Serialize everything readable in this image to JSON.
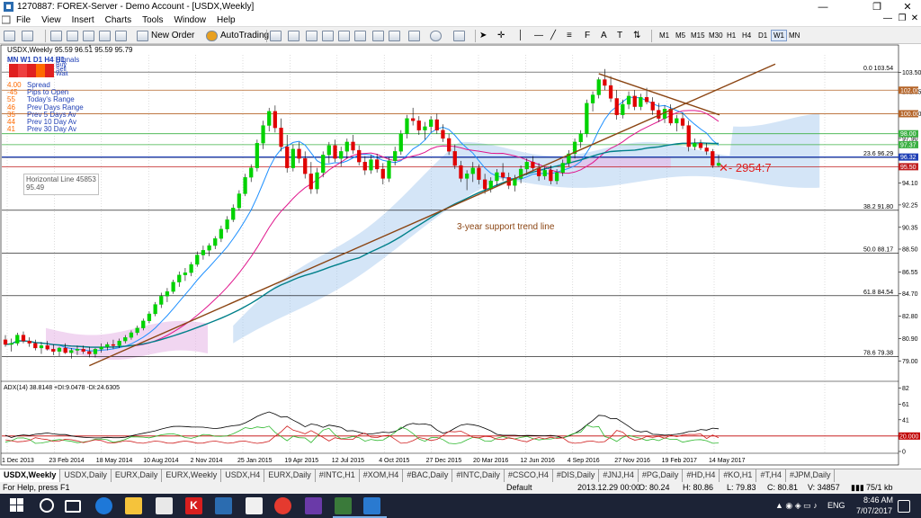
{
  "window": {
    "title": "1270887: FOREX-Server - Demo Account - [USDX,Weekly]",
    "minimize": "—",
    "maximize": "❐",
    "close": "✕"
  },
  "menu": {
    "items": [
      "File",
      "View",
      "Insert",
      "Charts",
      "Tools",
      "Window",
      "Help"
    ]
  },
  "toolbar": {
    "new_order": "New Order",
    "autotrading": "AutoTrading",
    "timeframes": [
      "M1",
      "M5",
      "M15",
      "M30",
      "H1",
      "H4",
      "D1",
      "W1",
      "MN"
    ],
    "active_timeframe": "W1"
  },
  "chart": {
    "header": "USDX,Weekly  95.59 96.51 95.59 95.79",
    "signals_panel": {
      "timeframes": "MN W1 D1  H4  H1",
      "signals": "Signals",
      "buy": "Buy",
      "sell": "Sell",
      "wait": "Wait",
      "lines": [
        {
          "value": "4.00",
          "label": "Spread"
        },
        {
          "value": "-45",
          "label": "Pips to Open"
        },
        {
          "value": "55",
          "label": "Today's Range"
        },
        {
          "value": "46",
          "label": "Prev Days Range"
        },
        {
          "value": "35",
          "label": "Prev 5 Days Av"
        },
        {
          "value": "44",
          "label": "Prev 10 Day Av"
        },
        {
          "value": "41",
          "label": "Prev 30 Day Av"
        }
      ]
    },
    "tooltip": {
      "line1": "Horizontal Line 45853",
      "line2": "95.49"
    },
    "annotation_trendline": "3-year support trend line",
    "annotation_target": "2954:7",
    "fib_levels": [
      {
        "label": "0.0  103.54",
        "price": 103.54
      },
      {
        "label": "23.6  96.29",
        "price": 96.29
      },
      {
        "label": "38.2  91.80",
        "price": 91.8
      },
      {
        "label": "50.0  88.17",
        "price": 88.17
      },
      {
        "label": "61.8  84.54",
        "price": 84.54
      },
      {
        "label": "78.6  79.38",
        "price": 79.38
      }
    ],
    "price_axis": [
      "103.50",
      "101.85",
      "100.00",
      "97.90",
      "96.32",
      "94.10",
      "92.25",
      "90.35",
      "88.50",
      "86.55",
      "84.70",
      "82.80",
      "80.90",
      "79.00"
    ],
    "price_tags": [
      {
        "text": "102.00",
        "price": 102.0,
        "color": "#b46428"
      },
      {
        "text": "100.00",
        "price": 100.0,
        "color": "#b46428"
      },
      {
        "text": "98.00",
        "price": 98.3,
        "color": "#3cb043"
      },
      {
        "text": "97.37",
        "price": 97.37,
        "color": "#3cb043"
      },
      {
        "text": "96.32",
        "price": 96.32,
        "color": "#1f3fb5"
      },
      {
        "text": "95.50",
        "price": 95.5,
        "color": "#c02020"
      }
    ],
    "time_axis": [
      "1 Dec 2013",
      "23 Feb 2014",
      "18 May 2014",
      "10 Aug 2014",
      "2 Nov 2014",
      "25 Jan 2015",
      "19 Apr 2015",
      "12 Jul 2015",
      "4 Oct 2015",
      "27 Dec 2015",
      "20 Mar 2016",
      "12 Jun 2016",
      "4 Sep 2016",
      "27 Nov 2016",
      "19 Feb 2017",
      "14 May 2017"
    ],
    "adx_header": "ADX(14) 38.8148 +DI:9.0478 -DI:24.6305",
    "adx_axis": [
      "82",
      "61",
      "41",
      "20",
      "0"
    ],
    "adx_tag": "20.000"
  },
  "chart_data": {
    "type": "candlestick",
    "title": "USDX,Weekly",
    "ylim": [
      77.5,
      105
    ],
    "candles": [
      [
        80.8,
        81.2,
        80.2,
        80.4
      ],
      [
        80.4,
        80.9,
        79.8,
        80.5
      ],
      [
        80.5,
        81.4,
        80.3,
        81.2
      ],
      [
        81.2,
        81.5,
        80.5,
        80.7
      ],
      [
        80.7,
        81.0,
        80.2,
        80.5
      ],
      [
        80.5,
        80.8,
        79.9,
        80.1
      ],
      [
        80.1,
        80.6,
        79.6,
        80.3
      ],
      [
        80.3,
        80.7,
        79.9,
        80.0
      ],
      [
        80.0,
        80.4,
        79.5,
        79.8
      ],
      [
        79.8,
        80.2,
        79.4,
        80.1
      ],
      [
        80.1,
        80.5,
        79.6,
        79.7
      ],
      [
        79.7,
        80.1,
        79.2,
        79.9
      ],
      [
        79.9,
        80.3,
        79.5,
        80.0
      ],
      [
        80.0,
        80.3,
        79.6,
        79.8
      ],
      [
        79.8,
        80.2,
        79.3,
        79.6
      ],
      [
        79.6,
        80.1,
        79.3,
        80.0
      ],
      [
        80.0,
        80.5,
        79.7,
        80.2
      ],
      [
        80.2,
        80.6,
        79.9,
        80.4
      ],
      [
        80.4,
        80.8,
        80.0,
        80.3
      ],
      [
        80.3,
        80.9,
        80.1,
        80.7
      ],
      [
        80.7,
        81.2,
        80.5,
        81.0
      ],
      [
        81.0,
        81.6,
        80.8,
        81.4
      ],
      [
        81.4,
        82.0,
        81.2,
        81.8
      ],
      [
        81.8,
        82.6,
        81.6,
        82.4
      ],
      [
        82.4,
        83.2,
        82.2,
        83.0
      ],
      [
        83.0,
        84.0,
        82.8,
        83.8
      ],
      [
        83.8,
        84.8,
        83.5,
        84.5
      ],
      [
        84.5,
        85.2,
        84.0,
        84.9
      ],
      [
        84.9,
        85.9,
        84.7,
        85.7
      ],
      [
        85.7,
        86.6,
        85.3,
        86.3
      ],
      [
        86.3,
        86.9,
        85.8,
        86.5
      ],
      [
        86.5,
        87.4,
        86.2,
        87.2
      ],
      [
        87.2,
        88.3,
        87.0,
        88.0
      ],
      [
        88.0,
        88.8,
        87.6,
        88.4
      ],
      [
        88.4,
        89.0,
        87.9,
        88.8
      ],
      [
        88.8,
        89.6,
        88.5,
        89.4
      ],
      [
        89.4,
        90.5,
        89.1,
        90.2
      ],
      [
        90.2,
        91.3,
        89.9,
        91.0
      ],
      [
        91.0,
        92.3,
        90.8,
        92.0
      ],
      [
        92.0,
        93.5,
        91.8,
        93.2
      ],
      [
        93.2,
        94.9,
        93.0,
        94.6
      ],
      [
        94.6,
        95.7,
        94.2,
        95.4
      ],
      [
        95.4,
        97.8,
        95.1,
        97.5
      ],
      [
        97.5,
        99.4,
        97.0,
        99.0
      ],
      [
        99.0,
        100.5,
        98.5,
        100.2
      ],
      [
        100.2,
        100.7,
        98.4,
        98.8
      ],
      [
        98.8,
        99.6,
        96.8,
        97.2
      ],
      [
        97.2,
        98.2,
        95.0,
        95.4
      ],
      [
        95.4,
        97.4,
        95.1,
        97.0
      ],
      [
        97.0,
        97.6,
        95.8,
        96.2
      ],
      [
        96.2,
        96.8,
        94.5,
        94.9
      ],
      [
        94.9,
        95.9,
        93.2,
        93.6
      ],
      [
        93.6,
        95.4,
        93.2,
        95.0
      ],
      [
        95.0,
        96.8,
        94.6,
        96.5
      ],
      [
        96.5,
        97.6,
        95.8,
        97.3
      ],
      [
        97.3,
        97.8,
        95.9,
        96.2
      ],
      [
        96.2,
        97.2,
        95.5,
        96.8
      ],
      [
        96.8,
        97.9,
        96.2,
        97.6
      ],
      [
        97.6,
        98.2,
        96.6,
        96.9
      ],
      [
        96.9,
        97.3,
        95.6,
        95.9
      ],
      [
        95.9,
        96.4,
        94.8,
        95.2
      ],
      [
        95.2,
        96.5,
        94.9,
        96.1
      ],
      [
        96.1,
        96.6,
        95.0,
        95.3
      ],
      [
        95.3,
        95.8,
        94.0,
        94.5
      ],
      [
        94.5,
        96.3,
        94.2,
        96.0
      ],
      [
        96.0,
        97.2,
        95.6,
        96.8
      ],
      [
        96.8,
        98.6,
        96.5,
        98.3
      ],
      [
        98.3,
        99.9,
        97.9,
        99.6
      ],
      [
        99.6,
        100.5,
        99.0,
        99.4
      ],
      [
        99.4,
        99.8,
        98.2,
        98.6
      ],
      [
        98.6,
        99.3,
        97.8,
        98.9
      ],
      [
        98.9,
        99.8,
        98.4,
        99.5
      ],
      [
        99.5,
        100.0,
        98.3,
        98.6
      ],
      [
        98.6,
        99.1,
        97.6,
        97.9
      ],
      [
        97.9,
        98.3,
        96.5,
        96.8
      ],
      [
        96.8,
        97.4,
        95.3,
        95.6
      ],
      [
        95.6,
        96.0,
        94.2,
        94.5
      ],
      [
        94.5,
        95.2,
        93.5,
        94.9
      ],
      [
        94.9,
        95.9,
        94.2,
        95.4
      ],
      [
        95.4,
        95.7,
        94.0,
        94.4
      ],
      [
        94.4,
        94.9,
        93.2,
        93.6
      ],
      [
        93.6,
        94.6,
        93.3,
        94.3
      ],
      [
        94.3,
        95.3,
        93.9,
        95.0
      ],
      [
        95.0,
        95.8,
        94.3,
        94.6
      ],
      [
        94.6,
        95.0,
        93.6,
        93.9
      ],
      [
        93.9,
        94.8,
        93.4,
        94.5
      ],
      [
        94.5,
        95.6,
        94.1,
        95.3
      ],
      [
        95.3,
        96.2,
        94.8,
        95.9
      ],
      [
        95.9,
        96.4,
        95.1,
        95.4
      ],
      [
        95.4,
        95.8,
        94.3,
        94.7
      ],
      [
        94.7,
        95.5,
        94.4,
        95.2
      ],
      [
        95.2,
        95.6,
        94.0,
        94.3
      ],
      [
        94.3,
        95.3,
        94.0,
        95.0
      ],
      [
        95.0,
        96.1,
        94.7,
        95.8
      ],
      [
        95.8,
        96.9,
        95.5,
        96.6
      ],
      [
        96.6,
        97.9,
        96.2,
        97.6
      ],
      [
        97.6,
        98.6,
        97.1,
        98.3
      ],
      [
        98.3,
        101.2,
        98.0,
        100.9
      ],
      [
        100.9,
        101.9,
        100.2,
        101.6
      ],
      [
        101.6,
        103.1,
        101.3,
        102.9
      ],
      [
        102.9,
        103.8,
        102.0,
        102.4
      ],
      [
        102.4,
        103.2,
        101.0,
        101.3
      ],
      [
        101.3,
        102.0,
        99.5,
        99.9
      ],
      [
        99.9,
        101.2,
        99.6,
        100.8
      ],
      [
        100.8,
        101.9,
        100.4,
        101.5
      ],
      [
        101.5,
        102.0,
        100.3,
        100.6
      ],
      [
        100.6,
        101.7,
        100.3,
        101.4
      ],
      [
        101.4,
        102.2,
        100.8,
        101.0
      ],
      [
        101.0,
        101.4,
        99.9,
        100.3
      ],
      [
        100.3,
        100.9,
        99.3,
        99.6
      ],
      [
        99.6,
        100.7,
        99.2,
        100.4
      ],
      [
        100.4,
        100.8,
        99.0,
        99.2
      ],
      [
        99.2,
        99.9,
        98.5,
        99.6
      ],
      [
        99.6,
        100.1,
        98.7,
        99.0
      ],
      [
        99.0,
        99.4,
        96.8,
        97.2
      ],
      [
        97.2,
        97.9,
        96.9,
        97.5
      ],
      [
        97.5,
        97.8,
        96.9,
        97.1
      ],
      [
        97.1,
        97.5,
        96.5,
        96.8
      ],
      [
        96.8,
        97.0,
        95.4,
        95.6
      ],
      [
        95.6,
        96.5,
        95.5,
        95.8
      ]
    ],
    "moving_averages": [
      {
        "name": "fast",
        "color": "#1e90ff"
      },
      {
        "name": "slow",
        "color": "#e0158c"
      },
      {
        "name": "long",
        "color": "#00808a"
      }
    ],
    "adx": {
      "adx": 38.8148,
      "plus_di": 9.0478,
      "minus_di": 24.6305
    },
    "trendline_label": "3-year support trend line"
  },
  "tabs": [
    "USDX,Weekly",
    "USDX,Daily",
    "EURX,Daily",
    "EURX,Weekly",
    "USDX,H4",
    "EURX,Daily",
    "#INTC,H1",
    "#XOM,H4",
    "#BAC,Daily",
    "#INTC,Daily",
    "#CSCO,H4",
    "#DIS,Daily",
    "#JNJ,H4",
    "#PG,Daily",
    "#HD,H4",
    "#KO,H1",
    "#T,H4",
    "#JPM,Daily"
  ],
  "status": {
    "help": "For Help, press F1",
    "profile": "Default",
    "datetime": "2013.12.29 00:00",
    "open": "O: 80.24",
    "high": "H: 80.86",
    "low": "L: 79.83",
    "close": "C: 80.81",
    "volume": "V: 34857",
    "connection": "75/1 kb"
  },
  "taskbar": {
    "lang": "ENG",
    "time": "8:46 AM",
    "date": "7/07/2017"
  },
  "colors": {
    "bull": "#00d200",
    "bear": "#e00000",
    "fib_line": "#000000",
    "ichimoku_cloud": "#7ab0e8",
    "trendline": "#8b4513"
  }
}
